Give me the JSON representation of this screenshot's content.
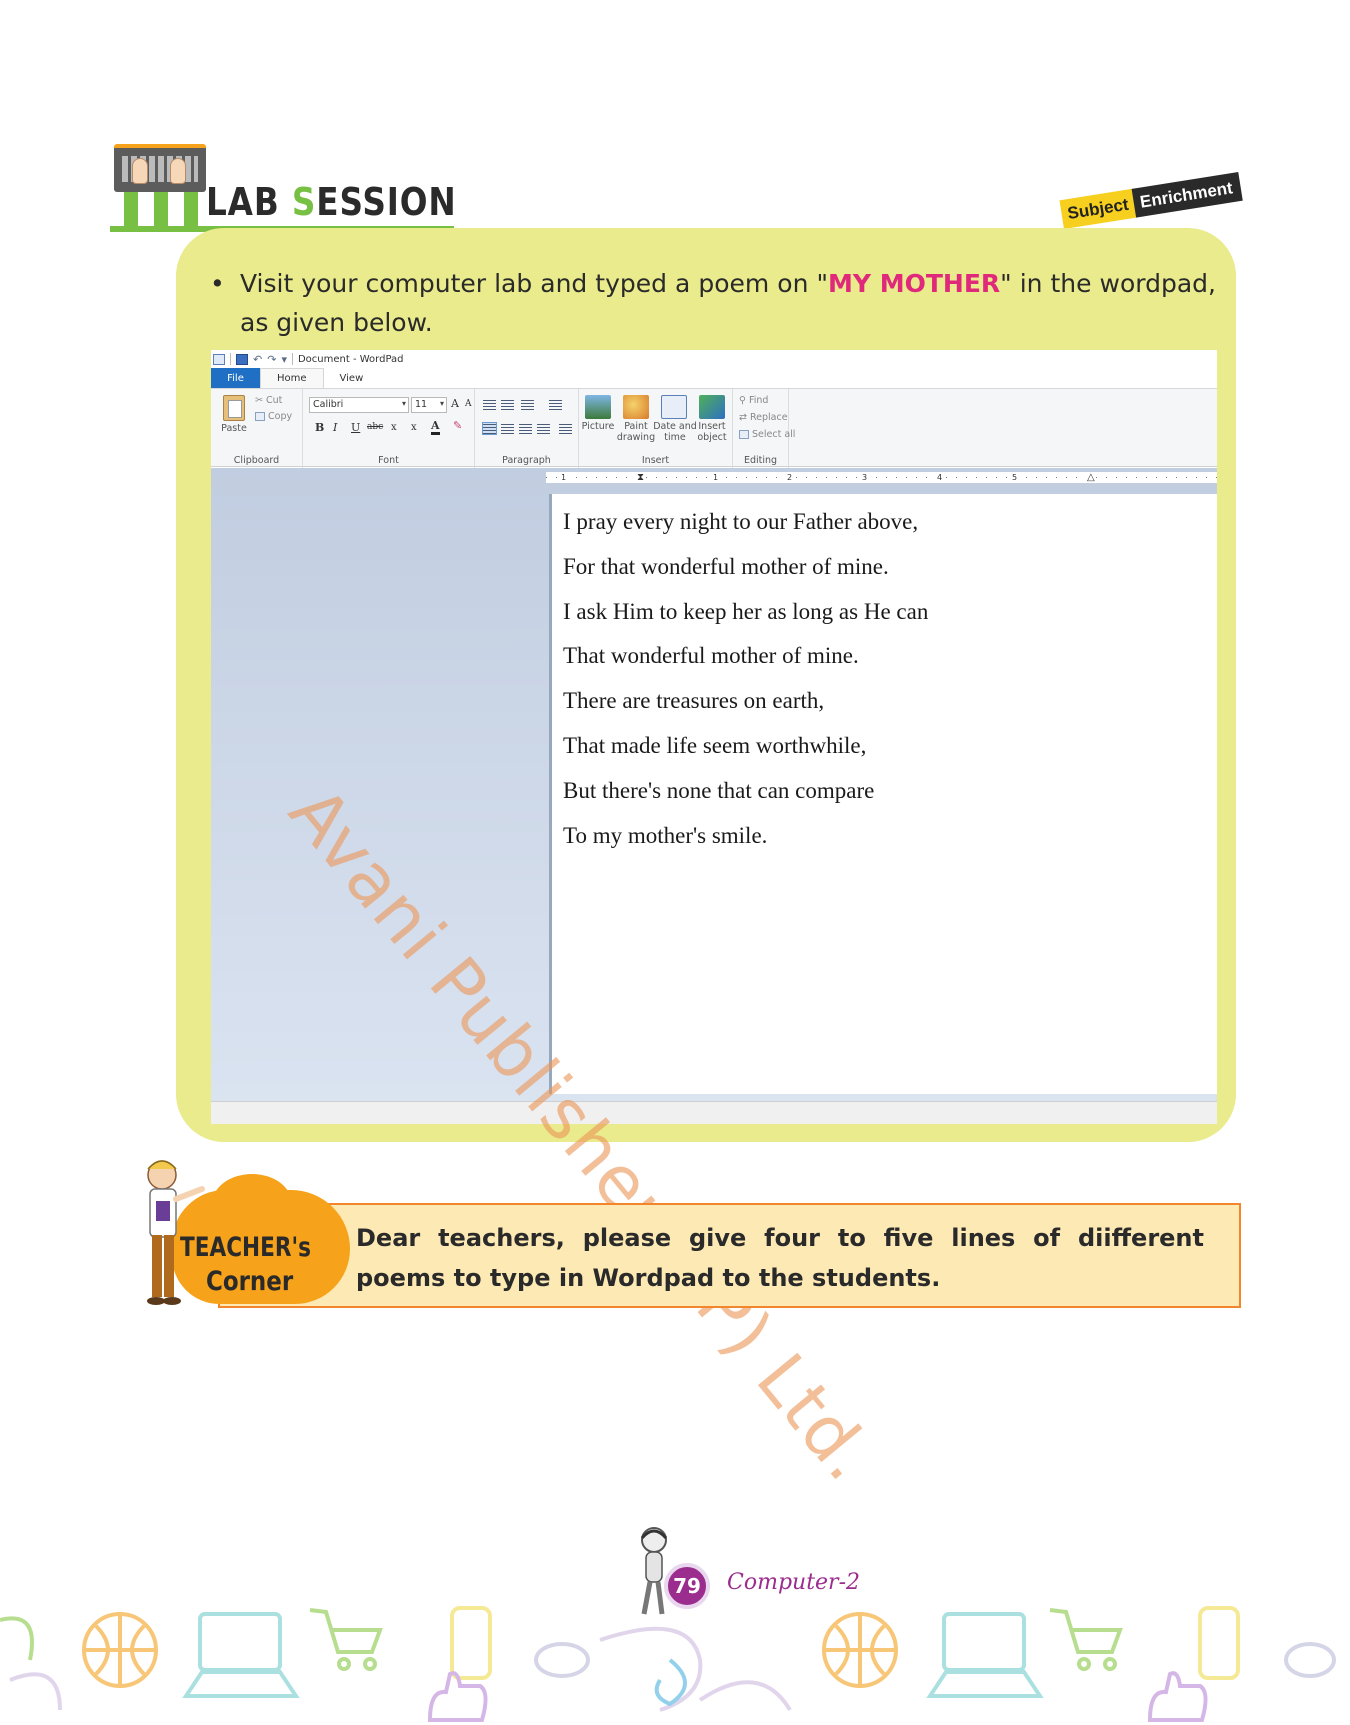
{
  "header": {
    "title_part1": "LAB ",
    "title_s": "S",
    "title_part2": "ESSION"
  },
  "badge": {
    "subject": "Subject",
    "enrichment": "Enrichment"
  },
  "instruction": {
    "bullet": "•",
    "before": "Visit your computer lab and typed a poem on \"",
    "highlight": "MY MOTHER",
    "after": "\" in the wordpad, as given below."
  },
  "wordpad": {
    "window_title": "Document - WordPad",
    "tabs": {
      "file": "File",
      "home": "Home",
      "view": "View"
    },
    "clipboard": {
      "paste": "Paste",
      "cut": "Cut",
      "copy": "Copy",
      "group": "Clipboard"
    },
    "font": {
      "family": "Calibri",
      "size": "11",
      "grow": "A",
      "shrink": "A",
      "bold": "B",
      "italic": "I",
      "underline": "U",
      "strike": "abc",
      "subscript": "x",
      "superscript": "x",
      "color": "A",
      "group": "Font"
    },
    "paragraph": {
      "group": "Paragraph"
    },
    "insert": {
      "picture": "Picture",
      "paint_drawing_1": "Paint",
      "paint_drawing_2": "drawing",
      "date_time_1": "Date and",
      "date_time_2": "time",
      "insert_object_1": "Insert",
      "insert_object_2": "object",
      "group": "Insert"
    },
    "editing": {
      "find": "Find",
      "replace": "Replace",
      "select_all": "Select all",
      "group": "Editing"
    },
    "ruler": [
      "1",
      "1",
      "2",
      "3",
      "4",
      "5"
    ],
    "poem": [
      "I pray every night to our Father above,",
      "For that wonderful mother of mine.",
      "I ask Him to keep her as long as He can",
      "That wonderful mother of mine.",
      "There are treasures on earth,",
      "That made life seem worthwhile,",
      "But there's none that can compare",
      "To my mother's smile."
    ]
  },
  "watermark": "Avani Publishers (P) Ltd.",
  "teachers_corner": {
    "label_line1": "TEACHER's",
    "label_line2": "Corner",
    "text": "Dear teachers, please give four to five lines of diifferent poems to type in Wordpad to the students."
  },
  "footer": {
    "page_number": "79",
    "book": "Computer-2"
  },
  "colors": {
    "panel": "#e9eb8c",
    "highlight": "#e0297a",
    "accent_green": "#77c043",
    "accent_orange": "#f7a21b",
    "page_badge": "#9b2d8f"
  }
}
